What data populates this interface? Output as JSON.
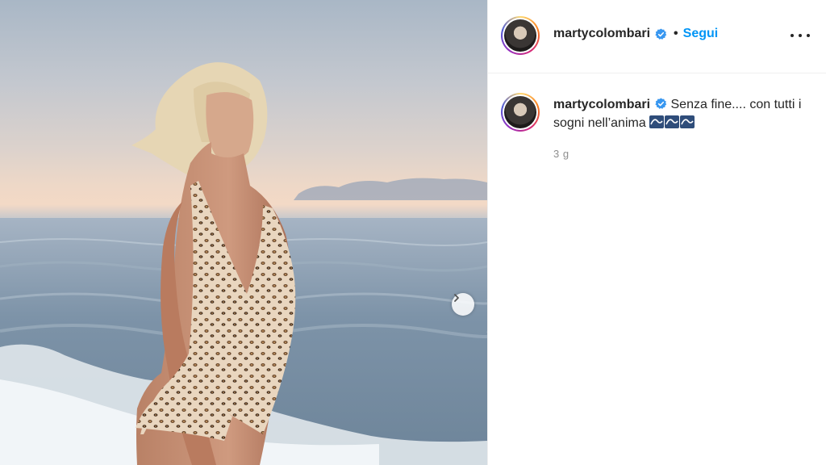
{
  "post": {
    "username": "martycolombari",
    "follow_label": "Segui",
    "separator": "•",
    "caption_username": "martycolombari",
    "caption_text": "Senza fine.... con tutti i sogni nell’anima",
    "time_ago": "3 g"
  },
  "icons": {
    "verified": "verified-badge-icon",
    "more": "more-options-icon",
    "next": "chevron-right-icon",
    "emoji": "wave-emoji-icon"
  },
  "colors": {
    "accent": "#0095f6",
    "text": "#262626",
    "muted": "#8e8e8e",
    "verified": "#3897f0"
  }
}
